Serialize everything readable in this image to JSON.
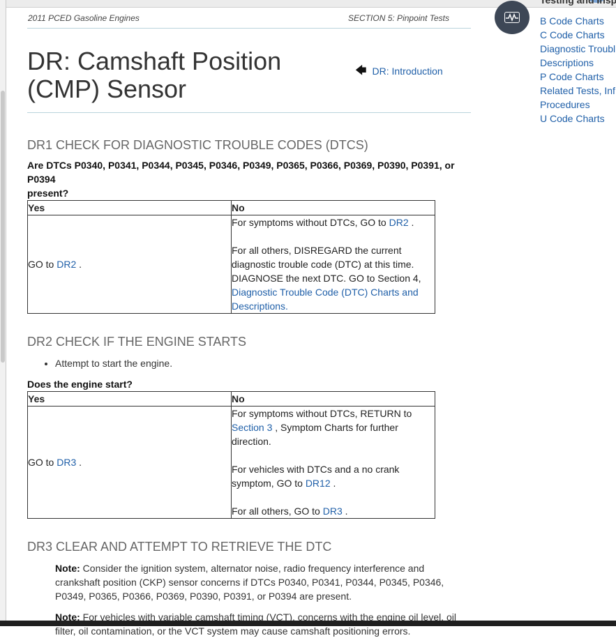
{
  "doc_header": {
    "left": "2011 PCED Gasoline Engines",
    "right": "SECTION 5: Pinpoint Tests"
  },
  "title": {
    "line1": "DR: Camshaft Position",
    "line2": "(CMP) Sensor"
  },
  "back_link": "DR: Introduction",
  "sidebar": {
    "cut_heading": "Testing and Inspe",
    "links": [
      "B Code Charts",
      "C Code Charts",
      "Diagnostic Troubl",
      "Descriptions",
      "P Code Charts",
      "Related Tests, Inf",
      "Procedures",
      "U Code Charts"
    ]
  },
  "dr1": {
    "heading": "DR1 CHECK FOR DIAGNOSTIC TROUBLE CODES (DTCS)",
    "question_line1": "Are DTCs P0340, P0341, P0344, P0345, P0346, P0349, P0365, P0366, P0369, P0390, P0391, or P0394",
    "question_line2": "present?",
    "yes_header": "Yes",
    "no_header": "No",
    "yes_text": "GO to ",
    "yes_link": "DR2",
    "yes_end": " .",
    "no_1_text": "For symptoms without DTCs, GO to ",
    "no_1_link": "DR2",
    "no_1_end": " .",
    "no_2_a": "For all others, DISREGARD the current",
    "no_2_b": "diagnostic trouble code (DTC) at this time.",
    "no_2_c": "DIAGNOSE the next DTC. GO to Section 4,",
    "no_2_link_a": "Diagnostic Trouble Code (DTC) Charts and",
    "no_2_link_b": "Descriptions",
    "no_2_end": "."
  },
  "dr2": {
    "heading": "DR2 CHECK IF THE ENGINE STARTS",
    "bullet": "Attempt to start the engine.",
    "question": "Does the engine start?",
    "yes_header": "Yes",
    "no_header": "No",
    "yes_text": "GO to ",
    "yes_link": "DR3",
    "yes_end": " .",
    "no_1_a": "For symptoms without DTCs, RETURN to",
    "no_1_link": "Section 3",
    "no_1_b": " , Symptom Charts for further",
    "no_1_c": "direction.",
    "no_2_a": "For vehicles with DTCs and a no crank",
    "no_2_b": "symptom, GO to ",
    "no_2_link": "DR12",
    "no_2_end": " .",
    "no_3_a": "For all others, GO to ",
    "no_3_link": "DR3",
    "no_3_end": " ."
  },
  "dr3": {
    "heading": "DR3 CLEAR AND ATTEMPT TO RETRIEVE THE DTC",
    "note_label": "Note:",
    "note1_a": " Consider the ignition system, alternator noise, radio frequency interference and",
    "note1_b": "crankshaft position (CKP) sensor concerns if DTCs P0340, P0341, P0344, P0345, P0346,",
    "note1_c": "P0349, P0365, P0366, P0369, P0390, P0391, or P0394 are present.",
    "note2_a": " For vehicles with variable camshaft timing (VCT), concerns with the engine oil level, oil",
    "note2_b": "filter, oil contamination, or the VCT system may cause camshaft positioning errors."
  }
}
